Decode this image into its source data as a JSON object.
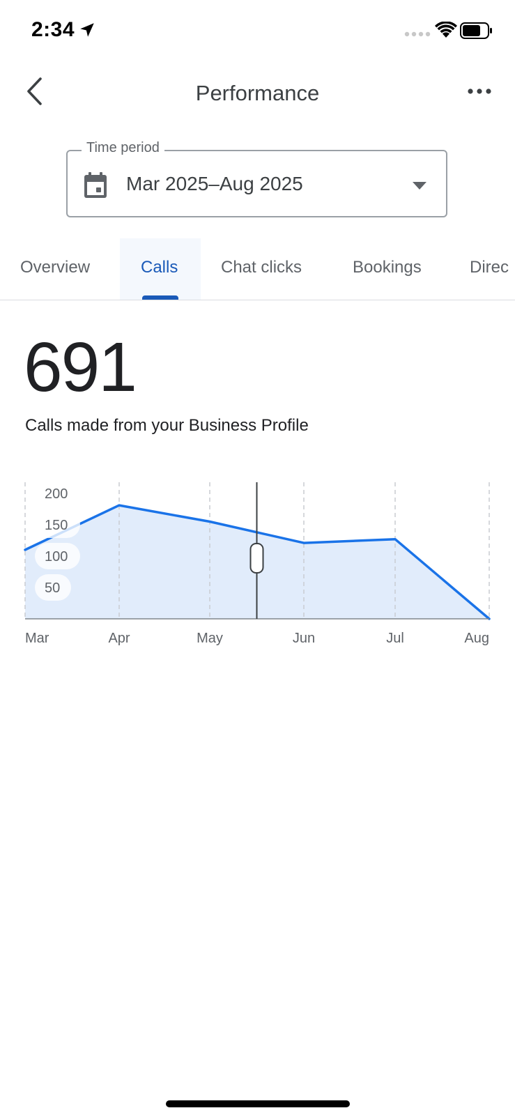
{
  "status_bar": {
    "time": "2:34"
  },
  "app_bar": {
    "title": "Performance"
  },
  "time_period": {
    "label": "Time period",
    "value": "Mar 2025–Aug 2025"
  },
  "tabs": [
    {
      "label": "Overview",
      "active": false
    },
    {
      "label": "Calls",
      "active": true
    },
    {
      "label": "Chat clicks",
      "active": false
    },
    {
      "label": "Bookings",
      "active": false
    },
    {
      "label": "Direc",
      "active": false
    }
  ],
  "metric": {
    "value": "691",
    "description": "Calls made from your Business Profile"
  },
  "colors": {
    "accent": "#1a5ab8",
    "line": "#1a73e8",
    "area": "#e1ecfb"
  },
  "chart_data": {
    "type": "area",
    "x": [
      "Mar",
      "Apr",
      "May",
      "Jun",
      "Jul",
      "Aug"
    ],
    "series": [
      {
        "values": [
          110,
          181,
          155,
          121,
          127,
          0
        ]
      }
    ],
    "y_ticks": [
      50,
      100,
      150,
      200
    ],
    "ylim": [
      0,
      200
    ],
    "grid": "vertical dashed",
    "scrubber_month_position": 2.5
  }
}
